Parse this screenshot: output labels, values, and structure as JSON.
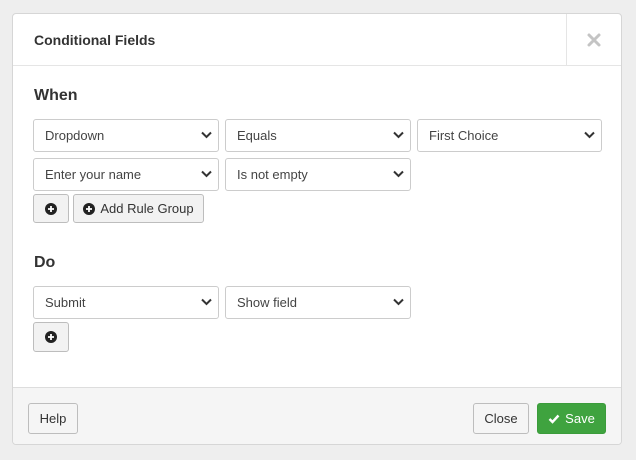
{
  "dialog": {
    "title": "Conditional Fields",
    "close_icon": "close-icon"
  },
  "when": {
    "title": "When",
    "rules": [
      {
        "field": "Dropdown",
        "operator": "Equals",
        "value": "First Choice"
      },
      {
        "field": "Enter your name",
        "operator": "Is not empty"
      }
    ],
    "add_rule_icon": "plus-circle-icon",
    "add_group_label": "Add Rule Group"
  },
  "do": {
    "title": "Do",
    "actions": [
      {
        "field": "Submit",
        "action": "Show field"
      }
    ],
    "add_action_icon": "plus-circle-icon"
  },
  "footer": {
    "help_label": "Help",
    "close_label": "Close",
    "save_label": "Save",
    "save_color": "#3fa33f"
  }
}
